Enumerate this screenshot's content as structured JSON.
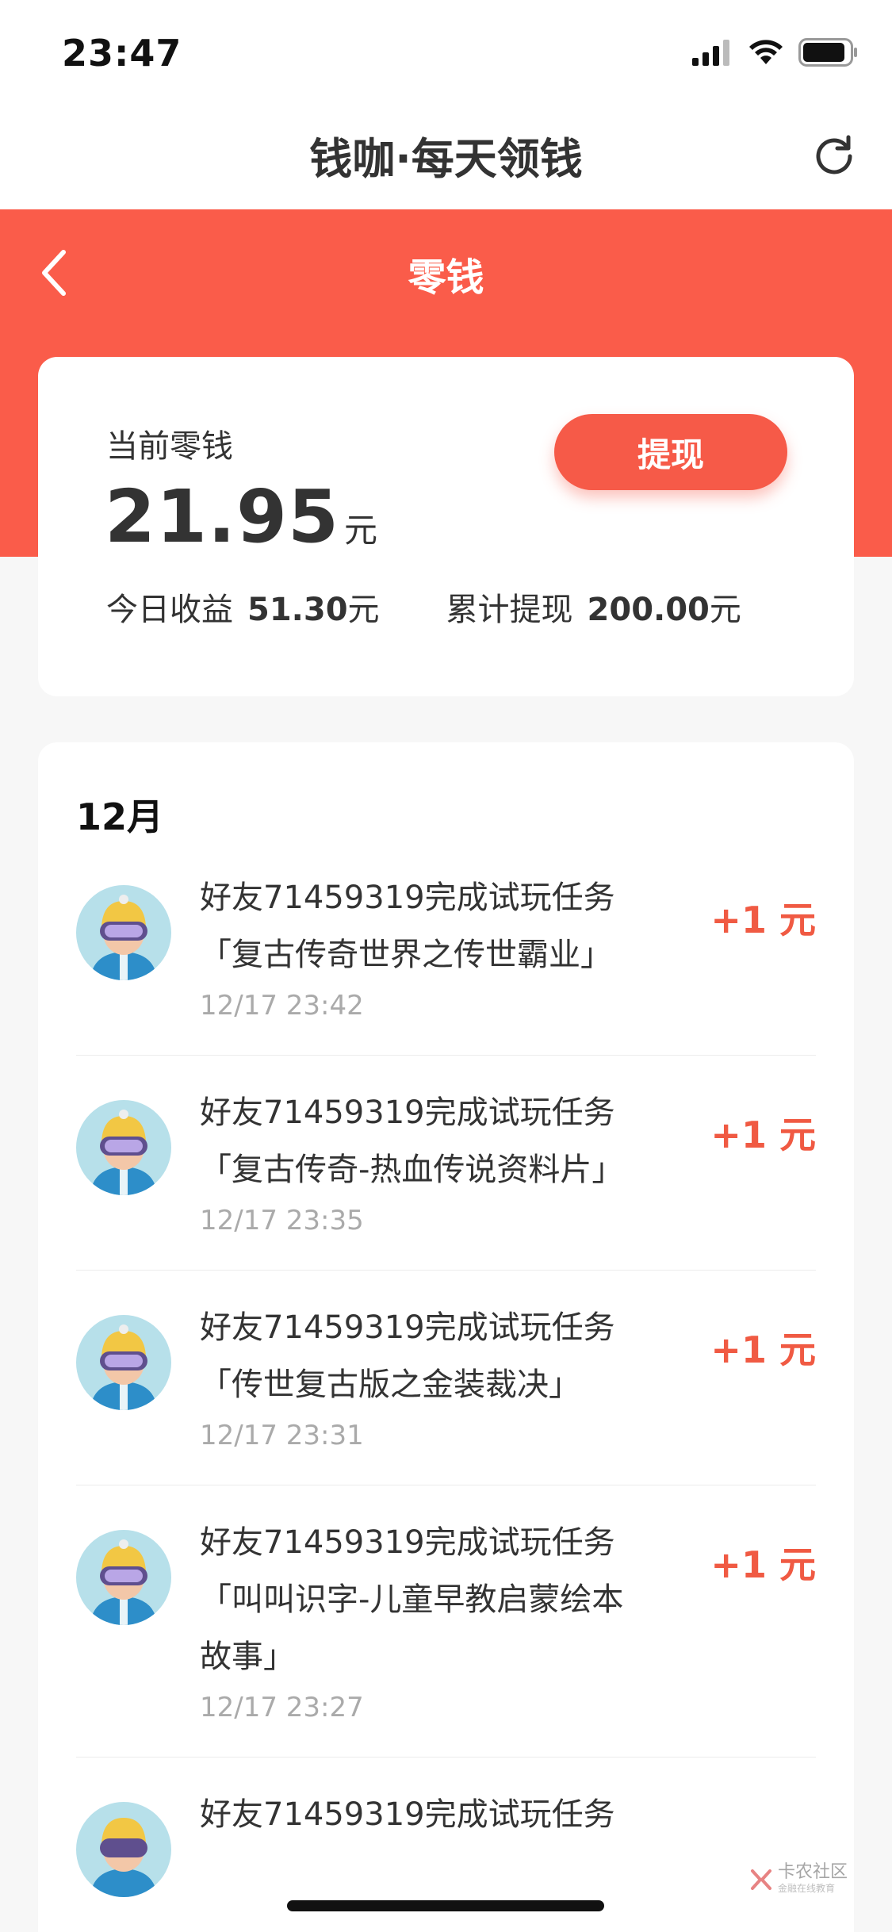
{
  "status_bar": {
    "time": "23:47"
  },
  "nav": {
    "title": "钱咖·每天领钱"
  },
  "header": {
    "title": "零钱"
  },
  "balance": {
    "label": "当前零钱",
    "amount": "21.95",
    "unit": "元",
    "withdraw_label": "提现",
    "today_label": "今日收益",
    "today_value": "51.30",
    "today_unit": "元",
    "total_label": "累计提现",
    "total_value": "200.00",
    "total_unit": "元"
  },
  "records": {
    "month": "12月",
    "items": [
      {
        "line1": "好友71459319完成试玩任务",
        "line2": "「复古传奇世界之传世霸业」",
        "time": "12/17 23:42",
        "amount": "+1 元"
      },
      {
        "line1": "好友71459319完成试玩任务",
        "line2": "「复古传奇-热血传说资料片」",
        "time": "12/17 23:35",
        "amount": "+1 元"
      },
      {
        "line1": "好友71459319完成试玩任务",
        "line2": "「传世复古版之金装裁决」",
        "time": "12/17 23:31",
        "amount": "+1 元"
      },
      {
        "line1": "好友71459319完成试玩任务",
        "line2": "「叫叫识字-儿童早教启蒙绘本故事」",
        "time": "12/17 23:27",
        "amount": "+1 元"
      },
      {
        "line1": "好友71459319完成试玩任务",
        "line2": "",
        "time": "",
        "amount": ""
      }
    ]
  },
  "watermark": {
    "text": "卡农社区",
    "sub": "金融在线教育"
  },
  "colors": {
    "accent": "#fa5c4a",
    "amount": "#f05a43"
  }
}
